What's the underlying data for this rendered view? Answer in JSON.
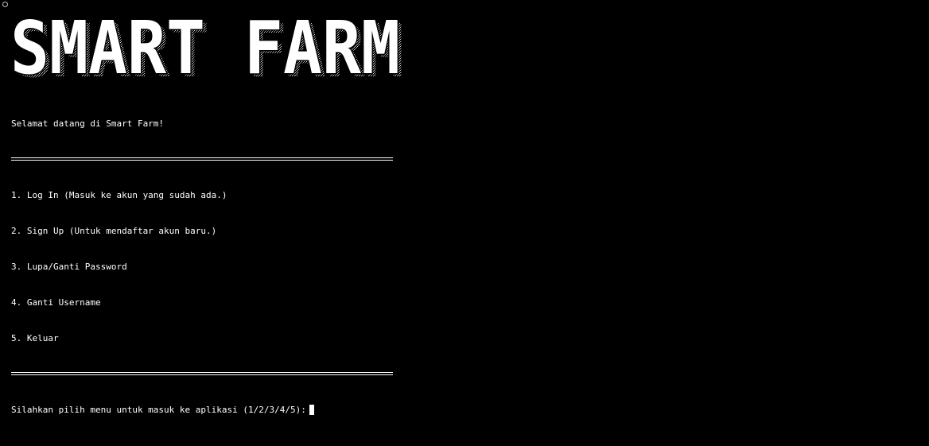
{
  "banner": {
    "text": "SMART FARM"
  },
  "terminal": {
    "welcome": "Selamat datang di Smart Farm!",
    "menu_items": [
      "1. Log In (Masuk ke akun yang sudah ada.)",
      "2. Sign Up (Untuk mendaftar akun baru.)",
      "3. Lupa/Ganti Password",
      "4. Ganti Username",
      "5. Keluar"
    ],
    "prompt": "Silahkan pilih menu untuk masuk ke aplikasi (1/2/3/4/5):"
  },
  "colors": {
    "background": "#000000",
    "foreground": "#ffffff"
  },
  "icons": {
    "window": "window-icon"
  }
}
